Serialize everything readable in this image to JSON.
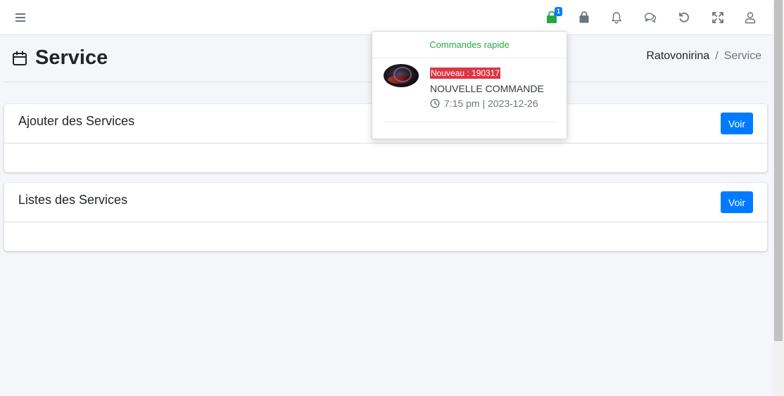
{
  "navbar": {
    "menu_icon": "bars-icon",
    "cart_badge": "1",
    "icons": [
      "shopping-bag-green-icon",
      "shopping-bag-icon",
      "bell-icon",
      "comments-icon",
      "undo-icon",
      "expand-icon",
      "user-icon"
    ]
  },
  "page": {
    "title": "Service",
    "title_icon": "calendar-icon"
  },
  "breadcrumb": {
    "home": "Ratovonirina",
    "separator": "/",
    "current": "Service"
  },
  "cards": [
    {
      "title": "Ajouter des Services",
      "button": "Voir"
    },
    {
      "title": "Listes des Services",
      "button": "Voir"
    }
  ],
  "dropdown": {
    "header": "Commandes rapide",
    "order": {
      "tag": "Nouveau : 190317",
      "title": "NOUVELLE COMMANDE",
      "time": "7:15 pm | 2023-12-26"
    }
  },
  "colors": {
    "accent": "#007bff",
    "success": "#28a745",
    "danger": "#dc3545",
    "cart_green": "#28a745"
  }
}
